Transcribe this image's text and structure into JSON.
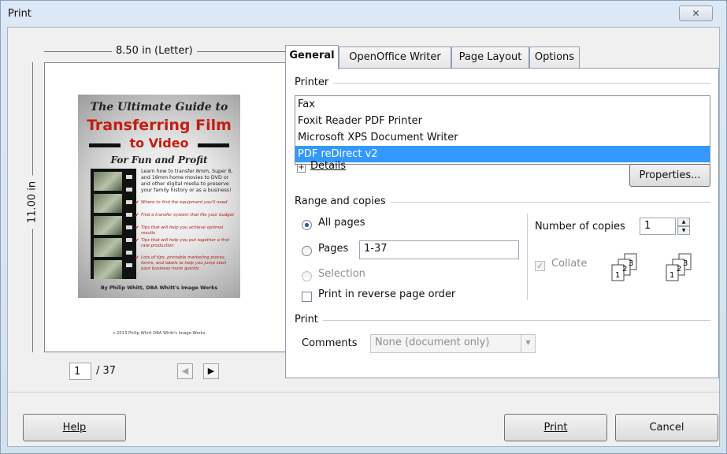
{
  "window": {
    "title": "Print",
    "close_glyph": "✕"
  },
  "preview": {
    "width_label": "8.50 in (Letter)",
    "height_label": "11.00 in",
    "cover": {
      "title_line1": "The Ultimate Guide to",
      "title_line2": "Transferring Film",
      "title_line3": "to Video",
      "title_line4": "For Fun and Profit",
      "intro": "Learn how to transfer 8mm, Super 8, and 16mm home movies to DVD or and other digital media to preserve your family history or as a business!",
      "bullets": [
        "Where to find the equipment you'll need",
        "Find a transfer system that fits your budget",
        "Tips that will help you achieve optimal results",
        "Tips that will help you put together a first rate production",
        "Lots of tips, printable marketing pieces, forms, and labels to help you jump start your business more quickly"
      ],
      "byline": "By Philip Whitt, DBA Whitt's Image Works",
      "copyright": "c 2013 Philip Whitt DBA Whitt's Image Works"
    },
    "page_current": "1",
    "page_total": "/ 37",
    "prev_icon": "◀",
    "next_icon": "▶"
  },
  "tabs": [
    {
      "label": "General",
      "selected": true
    },
    {
      "label": "OpenOffice Writer",
      "selected": false
    },
    {
      "label": "Page Layout",
      "selected": false
    },
    {
      "label": "Options",
      "selected": false
    }
  ],
  "printer": {
    "group_label": "Printer",
    "list": [
      "Fax",
      "Foxit Reader PDF Printer",
      "Microsoft XPS Document Writer",
      "PDF reDirect v2"
    ],
    "selected_index": 3,
    "details_label": "Details",
    "details_icon": "+",
    "properties_label": "Properties..."
  },
  "range": {
    "group_label": "Range and copies",
    "all_pages": "All pages",
    "pages": "Pages",
    "pages_value": "1-37",
    "selection": "Selection",
    "reverse": "Print in reverse page order",
    "copies_label": "Number of copies",
    "copies_value": "1",
    "collate": "Collate",
    "collate_check": "✓",
    "spin_up": "▲",
    "spin_down": "▼"
  },
  "print": {
    "group_label": "Print",
    "comments_label": "Comments",
    "comments_value": "None (document only)",
    "dropdown_icon": "▼"
  },
  "buttons": {
    "help": "Help",
    "print": "Print",
    "cancel": "Cancel"
  },
  "colors": {
    "selection": "#3399ff",
    "cover_red": "#c41d12"
  }
}
